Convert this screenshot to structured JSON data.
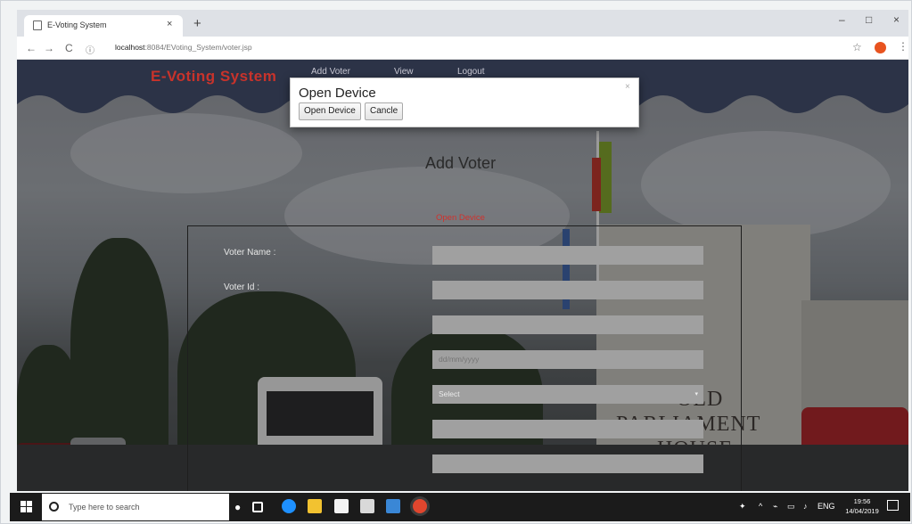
{
  "browser": {
    "tab_title": "E-Voting System",
    "tab_close": "×",
    "new_tab": "+",
    "window_controls": {
      "minimize": "–",
      "maximize": "□",
      "close": "×"
    },
    "url_prefix": "localhost",
    "url_rest": ":8084/EVoting_System/voter.jsp",
    "back_icon": "←",
    "forward_icon": "→",
    "reload_icon": "C",
    "info_icon": "ⓘ",
    "star_icon": "☆",
    "menu_icon": "⋮"
  },
  "header": {
    "brand": "E-Voting System",
    "nav": [
      "Add Voter",
      "View",
      "Logout"
    ]
  },
  "modal": {
    "title": "Open Device",
    "close": "×",
    "open_button": "Open Device",
    "cancel_button": "Cancle"
  },
  "page": {
    "heading": "Add Voter",
    "open_device_link": "Open Device",
    "labels": [
      "Voter Name :",
      "Voter Id :"
    ],
    "inputs": [
      {
        "value": "",
        "placeholder": ""
      },
      {
        "value": "",
        "placeholder": ""
      },
      {
        "value": "",
        "placeholder": ""
      },
      {
        "value": "",
        "placeholder": "dd/mm/yyyy"
      },
      {
        "value": "Select",
        "placeholder": ""
      },
      {
        "value": "",
        "placeholder": ""
      },
      {
        "value": "",
        "placeholder": ""
      }
    ],
    "background_sign": [
      "OLD",
      "PARLIAMENT",
      "HOUSE"
    ]
  },
  "taskbar": {
    "search_placeholder": "Type here to search",
    "tray_lang": "ENG",
    "time": "19:56",
    "date": "14/04/2019"
  },
  "colors": {
    "brand_red": "#c8332b",
    "link_red": "#d0312d",
    "header_navy": "#2c3347",
    "input_gray": "#a0a0a0"
  }
}
